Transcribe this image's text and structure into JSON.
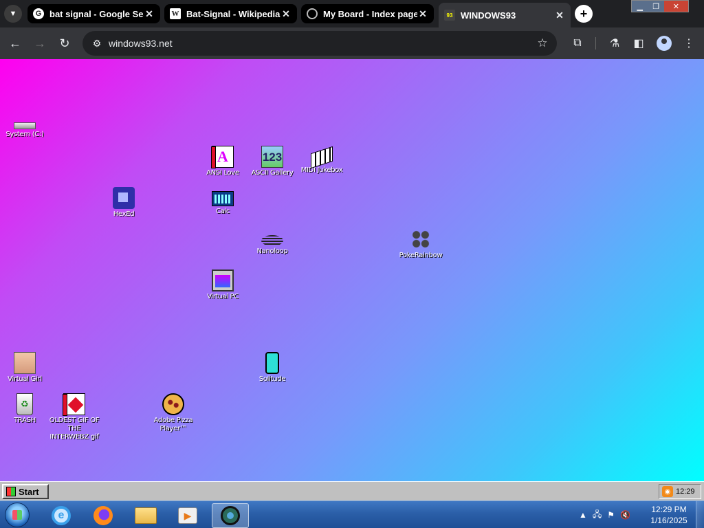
{
  "browser": {
    "tabs": [
      {
        "title": "bat signal - Google Sear",
        "favicon": "G"
      },
      {
        "title": "Bat-Signal - Wikipedia",
        "favicon": "W"
      },
      {
        "title": "My Board - Index page",
        "favicon": ""
      },
      {
        "title": "WINDOWS93",
        "favicon": "93"
      }
    ],
    "close_glyph": "✕",
    "new_tab_glyph": "+",
    "url": "windows93.net",
    "colors": {
      "frame": "#202124",
      "toolbar": "#35363a"
    }
  },
  "desktop": {
    "icons": [
      {
        "label": "System (C:)"
      },
      {
        "label": "ANSI Love"
      },
      {
        "label": "ASCII Gallery",
        "glyph": "123"
      },
      {
        "label": "MIDI Jukebox"
      },
      {
        "label": "HexEd"
      },
      {
        "label": "Calc"
      },
      {
        "label": "Nanoloop"
      },
      {
        "label": "PokeRainbow"
      },
      {
        "label": "Virtual PC"
      },
      {
        "label": "Virtual Girl"
      },
      {
        "label": "Solitude"
      },
      {
        "label": "TRASH"
      },
      {
        "label": "OLDEST GIF OF THE INTERWEBZ gif"
      },
      {
        "label": "Adobe Pizza Player™"
      }
    ],
    "ansi_glyph": "A"
  },
  "w93_taskbar": {
    "start_label": "Start",
    "clock": "12:29"
  },
  "win7_taskbar": {
    "time": "12:29 PM",
    "date": "1/16/2025",
    "ie_glyph": "e"
  }
}
